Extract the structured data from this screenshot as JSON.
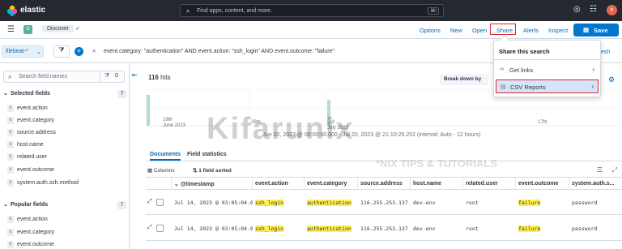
{
  "header": {
    "brand": "elastic",
    "search_placeholder": "Find apps, content, and more.",
    "search_shortcut": "⌘/",
    "user_initial": "e"
  },
  "appbar": {
    "space_initial": "D",
    "breadcrumb": "Discover",
    "links": [
      "Options",
      "New",
      "Open",
      "Share",
      "Alerts",
      "Inspect"
    ],
    "save_label": "Save"
  },
  "query": {
    "data_view": "filebeat-*",
    "text": "event.category: \"authentication\" AND event.action: \"ssh_login\" AND event.outcome: \"failure\"",
    "refresh_fragment": "esh"
  },
  "sidebar": {
    "search_placeholder": "Search field names",
    "filter_count": "0",
    "selected_label": "Selected fields",
    "selected_count": "7",
    "selected_fields": [
      "event.action",
      "event.category",
      "source.address",
      "host.name",
      "related.user",
      "event.outcome",
      "system.auth.ssh.method"
    ],
    "popular_label": "Popular fields",
    "popular_count": "7",
    "popular_fields": [
      "event.action",
      "event.category",
      "event.outcome"
    ]
  },
  "main": {
    "hits_count": "116",
    "hits_label": "hits",
    "breakdown_label": "Break down by",
    "chart_subtitle": "Jun 20, 2023 @ 00:00:00.000 - Jul 20, 2023 @ 21:10:29.252 (interval: Auto - 12 hours)",
    "tabs": [
      "Documents",
      "Field statistics"
    ],
    "columns_label": "Columns",
    "sorted_label": "1 field sorted"
  },
  "chart_data": {
    "type": "bar",
    "x_ticks": [
      "19th",
      "June 2023",
      "26th",
      "3rd",
      "July 2023",
      "17th"
    ],
    "ylim": [
      0,
      116
    ],
    "values": []
  },
  "grid": {
    "columns": [
      "@timestamp",
      "event.action",
      "event.category",
      "source.address",
      "host.name",
      "related.user",
      "event.outcome",
      "system.auth.s..."
    ],
    "rows": [
      [
        "Jul 14, 2023 @ 03:05:04.000",
        "ssh_login",
        "authentication",
        "116.255.253.137",
        "dev-env",
        "root",
        "failure",
        "password"
      ],
      [
        "Jul 14, 2023 @ 03:05:04.000",
        "ssh_login",
        "authentication",
        "116.255.253.137",
        "dev-env",
        "root",
        "failure",
        "password"
      ]
    ]
  },
  "share_popover": {
    "title": "Share this search",
    "items": [
      "Get links",
      "CSV Reports"
    ]
  },
  "watermark": {
    "main": "Kifarunix",
    "sub": "*NIX TIPS & TUTORIALS"
  }
}
